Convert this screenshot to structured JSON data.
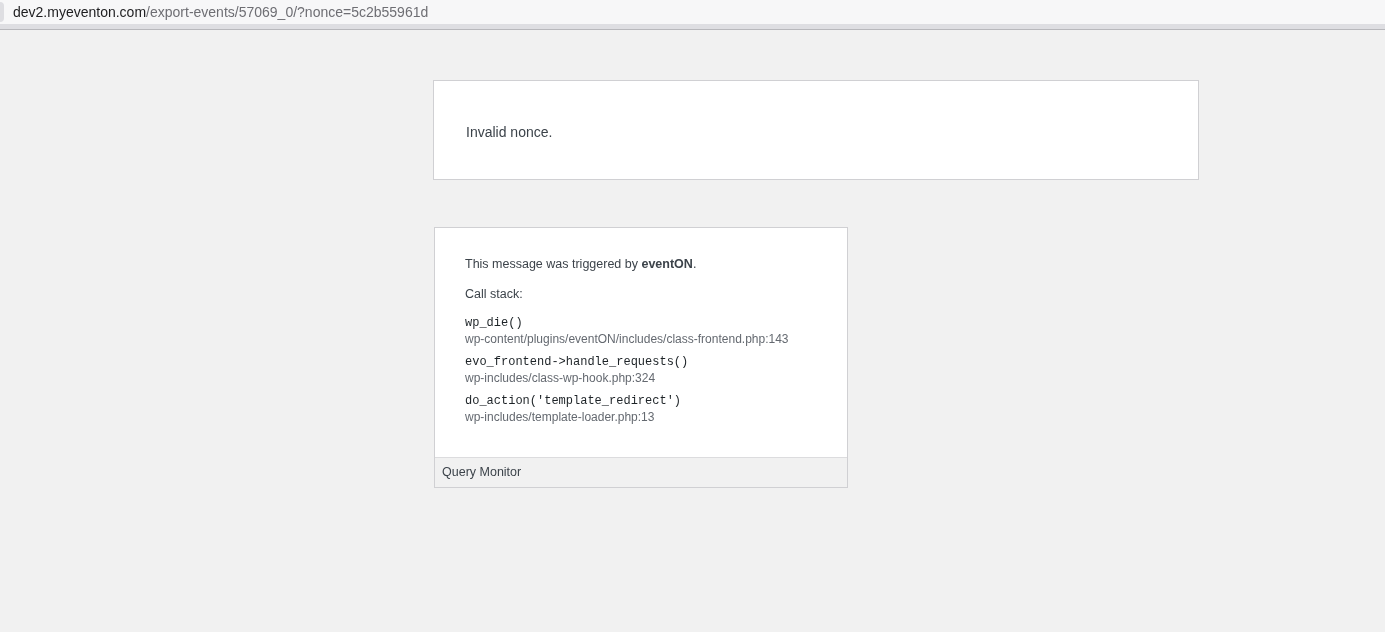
{
  "address_bar": {
    "host": "dev2.myeventon.com",
    "path": "/export-events/57069_0/?nonce=5c2b55961d"
  },
  "error_box": {
    "message": "Invalid nonce."
  },
  "query_monitor": {
    "trigger": "This message was triggered by **eventON**.",
    "call_stack_label": "Call stack:",
    "frames": [
      {
        "function": "wp_die()",
        "location": "wp-content/plugins/eventON/includes/class-frontend.php:143"
      },
      {
        "function": "evo_frontend->handle_requests()",
        "location": "wp-includes/class-wp-hook.php:324"
      },
      {
        "function": "do_action('template_redirect')",
        "location": "wp-includes/template-loader.php:13"
      }
    ],
    "footer": "Query Monitor"
  }
}
